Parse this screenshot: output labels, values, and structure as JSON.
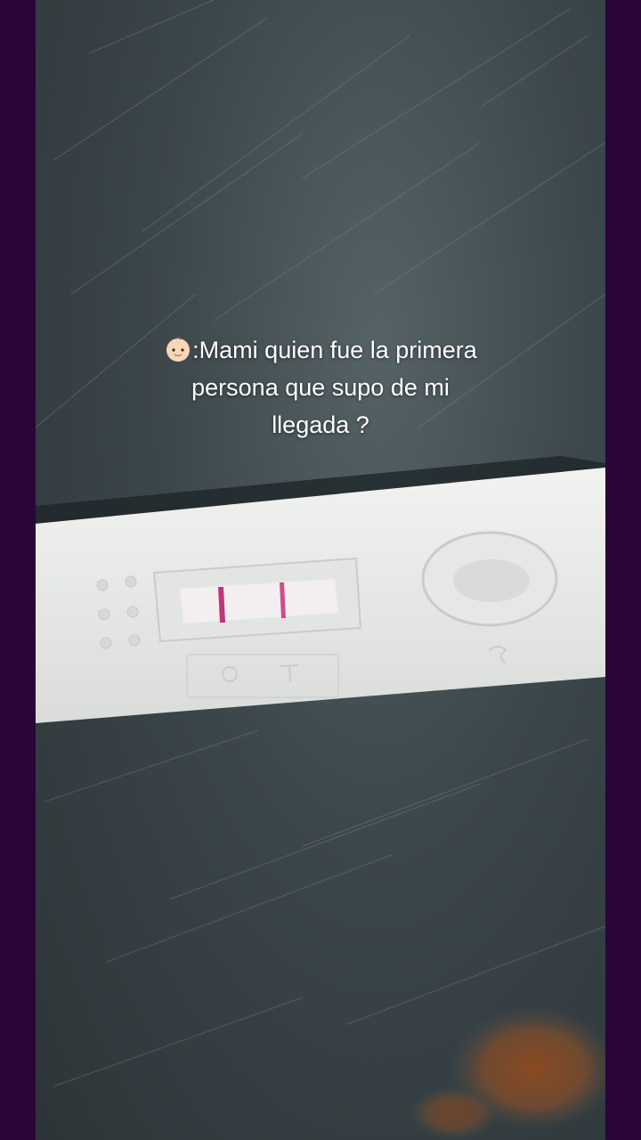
{
  "caption": {
    "emoji": "baby-face-icon",
    "line1": ":Mami quien fue la primera",
    "line2": "persona que supo de mi",
    "line3": "llegada ?"
  },
  "colors": {
    "side_bars": "#2a0539",
    "surface": "#3c474b",
    "test_body": "#e9ebe8",
    "test_lines": "#c2337a"
  },
  "test_strip_lines": 2
}
